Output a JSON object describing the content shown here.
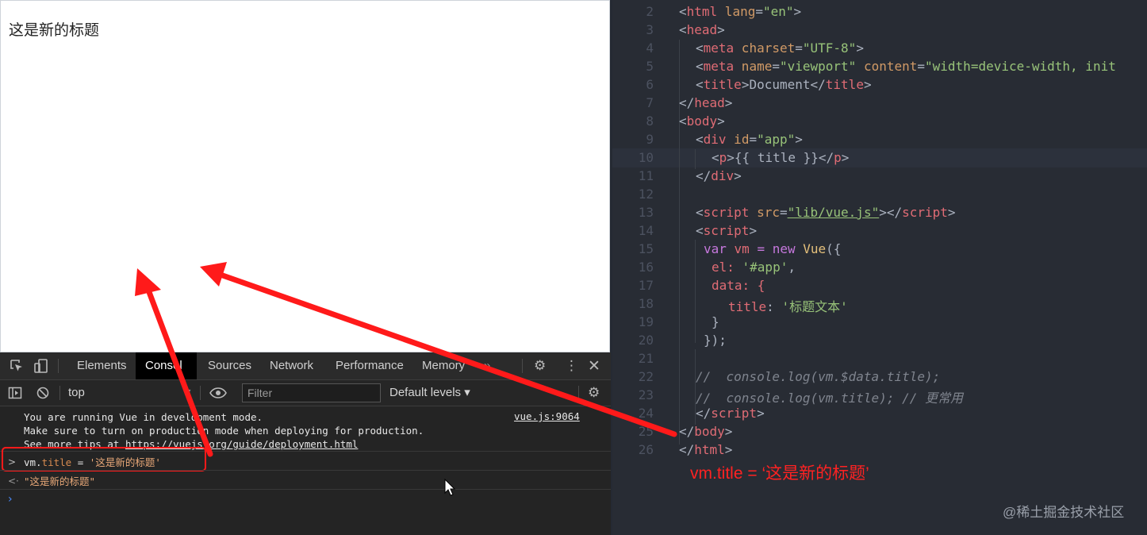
{
  "browser": {
    "page_text": "这是新的标题"
  },
  "devtools": {
    "tabs": [
      "Elements",
      "Consol",
      "Sources",
      "Network",
      "Performance",
      "Memory"
    ],
    "more_tabs": "»",
    "context": "top",
    "filter_placeholder": "Filter",
    "levels": "Default levels ▾",
    "console": {
      "warning_lines": [
        "You are running Vue in development mode.",
        "Make sure to turn on production mode when deploying for production.",
        "See more tips at "
      ],
      "warning_link": "https://vuejs.org/guide/deployment.html",
      "warning_source": "vue.js:9064",
      "input_object": "vm.",
      "input_prop": "title",
      "input_eq": " = ",
      "input_value": "'这是新的标题'",
      "output": "\"这是新的标题\""
    }
  },
  "editor": {
    "line_numbers": [
      "2",
      "3",
      "4",
      "5",
      "6",
      "7",
      "8",
      "9",
      "10",
      "11",
      "12",
      "13",
      "14",
      "15",
      "16",
      "17",
      "18",
      "19",
      "20",
      "21",
      "22",
      "23",
      "24",
      "25",
      "26"
    ],
    "lines": {
      "l2": {
        "open": "<",
        "tag": "html",
        "attr": " lang",
        "eq": "=",
        "val": "\"en\"",
        "close": ">"
      },
      "l3": {
        "open": "<",
        "tag": "head",
        "close": ">"
      },
      "l4": {
        "open": "<",
        "tag": "meta",
        "attr": " charset",
        "eq": "=",
        "val": "\"UTF-8\"",
        "close": ">"
      },
      "l5": {
        "open": "<",
        "tag": "meta",
        "attr1": " name",
        "eq1": "=",
        "val1": "\"viewport\"",
        "attr2": " content",
        "eq2": "=",
        "val2": "\"width=device-width, init"
      },
      "l6": {
        "open": "<",
        "tag": "title",
        "mid": ">Document</",
        "tag2": "title",
        "close": ">"
      },
      "l7": {
        "open": "</",
        "tag": "head",
        "close": ">"
      },
      "l8": {
        "open": "<",
        "tag": "body",
        "close": ">"
      },
      "l9": {
        "open": "<",
        "tag": "div",
        "attr": " id",
        "eq": "=",
        "val": "\"app\"",
        "close": ">"
      },
      "l10": {
        "open": "<",
        "tag": "p",
        "mid": ">{{ title }}</",
        "tag2": "p",
        "close": ">"
      },
      "l11": {
        "open": "</",
        "tag": "div",
        "close": ">"
      },
      "l13": {
        "open": "<",
        "tag": "script",
        "attr": " src",
        "eq": "=",
        "val": "\"lib/vue.js\"",
        "mid": "></",
        "tag2": "script",
        "close": ">"
      },
      "l14": {
        "open": "<",
        "tag": "script",
        "close": ">"
      },
      "l15": {
        "kw": "var",
        "rest": " vm ",
        "op": "=",
        "kw2": " new ",
        "fn": "Vue",
        "tail": "({"
      },
      "l16": {
        "text": "el: ",
        "str": "'#app'",
        "tail": ","
      },
      "l17": {
        "text": "data: {"
      },
      "l18": {
        "prop": "title",
        "text": ": ",
        "str": "'标题文本'"
      },
      "l19": {
        "text": "}"
      },
      "l20": {
        "text": "});"
      },
      "l22": {
        "comment": "//  console.log(vm.$data.title);"
      },
      "l23": {
        "comment": "//  console.log(vm.title); // 更常用"
      },
      "l24": {
        "open": "</",
        "tag": "script",
        "close": ">"
      },
      "l25": {
        "open": "</",
        "tag": "body",
        "close": ">"
      },
      "l26": {
        "open": "</",
        "tag": "html",
        "close": ">"
      }
    },
    "annotation": "vm.title = ‘这是新的标题’",
    "watermark": "@稀土掘金技术社区"
  },
  "colors": {
    "annotation_red": "#ff1a1a",
    "editor_bg": "#282c34",
    "devtools_bg": "#242424"
  }
}
